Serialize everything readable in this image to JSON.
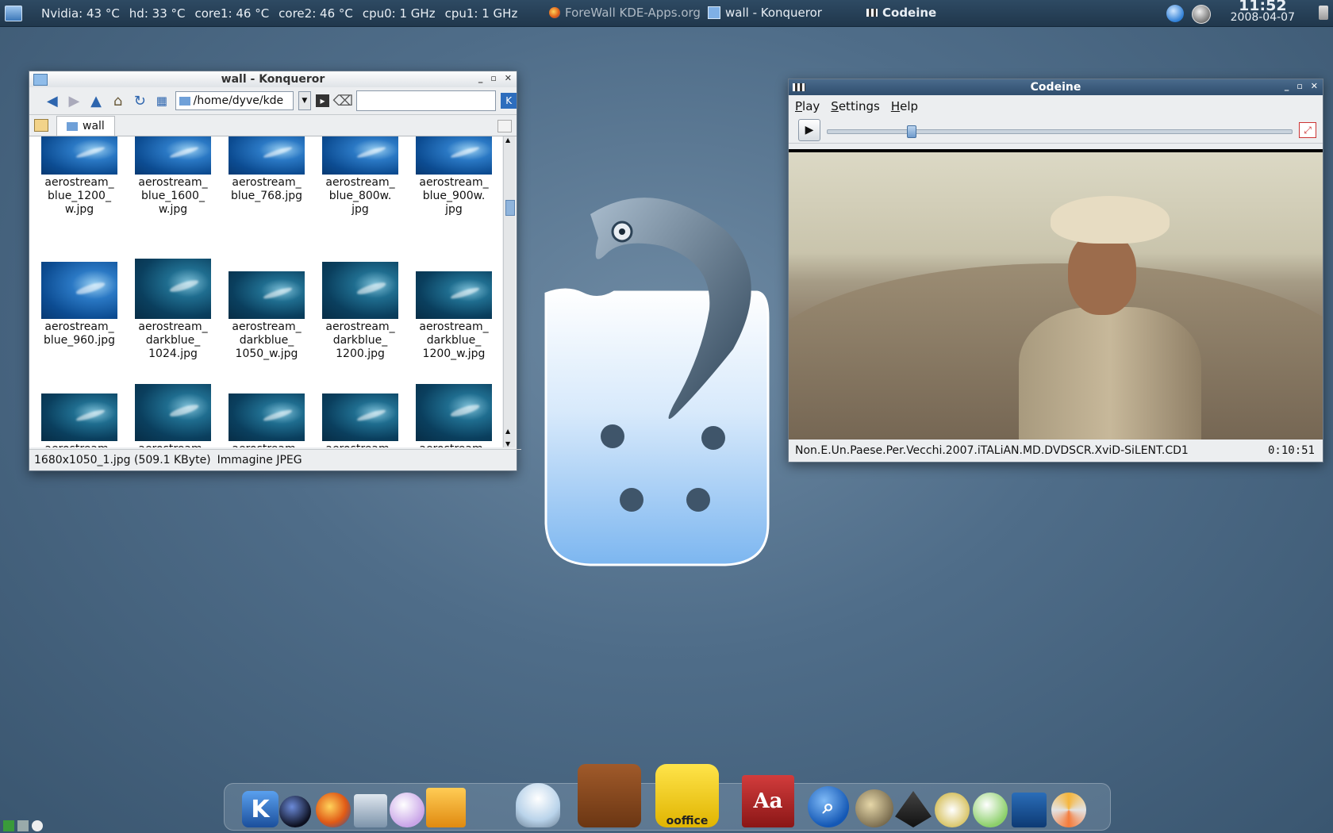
{
  "top_panel": {
    "sensors": [
      "Nvidia: 43 °C",
      "hd: 33 °C",
      "core1: 46 °C",
      "core2: 46 °C",
      "cpu0: 1 GHz",
      "cpu1: 1 GHz"
    ],
    "tasks": [
      {
        "label": "ForeWall KDE-Apps.org",
        "icon": "firefox-icon",
        "active": false
      },
      {
        "label": "wall - Konqueror",
        "icon": "folder-icon",
        "active": false
      },
      {
        "label": "Codeine",
        "icon": "clapper-icon",
        "active": true
      }
    ],
    "clock": {
      "time": "11:52",
      "date": "2008-04-07"
    }
  },
  "konqueror": {
    "title": "wall - Konqueror",
    "location": "/home/dyve/kde",
    "search_value": "",
    "tab_label": "wall",
    "files": [
      [
        "aerostream_",
        "blue_1200_",
        "w.jpg"
      ],
      [
        "aerostream_",
        "blue_1600_",
        "w.jpg"
      ],
      [
        "aerostream_",
        "blue_768.jpg"
      ],
      [
        "aerostream_",
        "blue_800w.",
        "jpg"
      ],
      [
        "aerostream_",
        "blue_900w.",
        "jpg"
      ],
      [
        "aerostream_",
        "blue_960.jpg"
      ],
      [
        "aerostream_",
        "darkblue_",
        "1024.jpg"
      ],
      [
        "aerostream_",
        "darkblue_",
        "1050_w.jpg"
      ],
      [
        "aerostream_",
        "darkblue_",
        "1200.jpg"
      ],
      [
        "aerostream_",
        "darkblue_",
        "1200_w.jpg"
      ],
      [
        "aerostream_"
      ],
      [
        "aerostream_"
      ],
      [
        "aerostream_"
      ],
      [
        "aerostream_"
      ],
      [
        "aerostream_"
      ]
    ],
    "status_file": "1680x1050_1.jpg (509.1 KByte)",
    "status_type": "Immagine JPEG"
  },
  "codeine": {
    "title": "Codeine",
    "menu": [
      "Play",
      "Settings",
      "Help"
    ],
    "seek_fraction": 0.18,
    "filename": "Non.E.Un.Paese.Per.Vecchi.2007.iTALiAN.MD.DVDSCR.XviD-SiLENT.CD1",
    "time": "0:10:51"
  },
  "dock": {
    "items": [
      "kde-icon",
      "kstars-icon",
      "firefox-icon",
      "kmail-icon",
      "kopete-icon",
      "amarok-icon",
      "bulb-icon",
      "cow-icon",
      "koffice-icon",
      "dictionary-icon",
      "search-icon",
      "gimp-icon",
      "inkscape-icon",
      "brush-icon",
      "music-icon",
      "draw-icon",
      "cd-icon"
    ],
    "koffice_label": "ooffice"
  }
}
